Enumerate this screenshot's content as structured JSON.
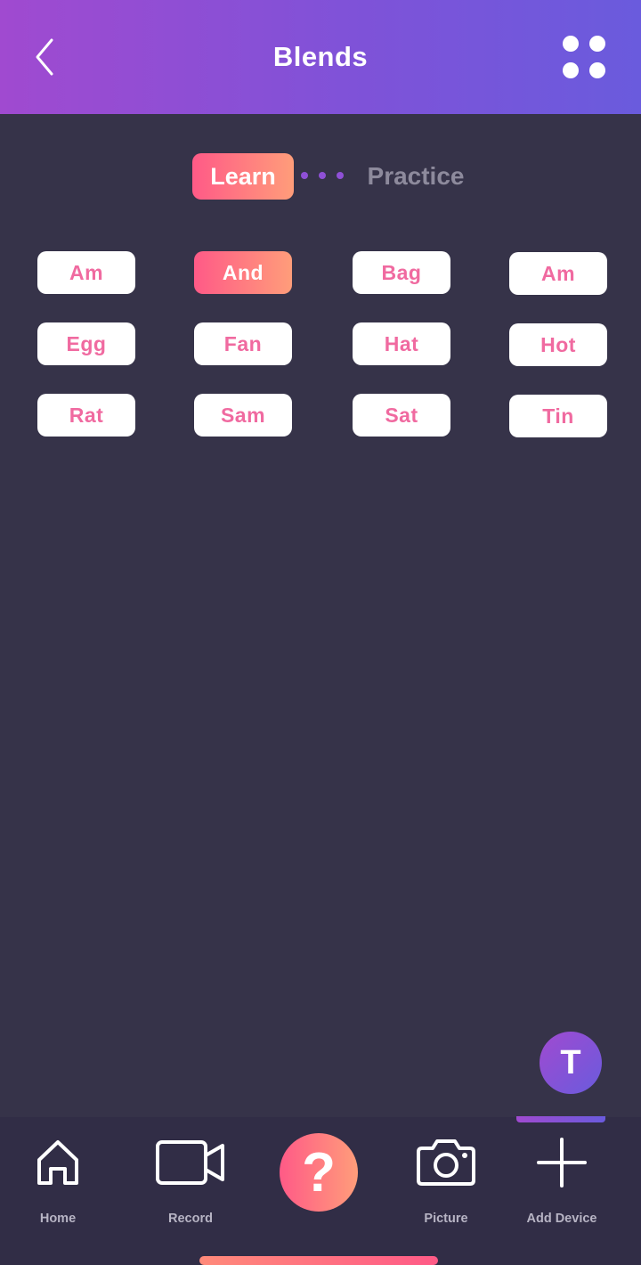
{
  "header": {
    "title": "Blends",
    "back_icon": "chevron-left-icon",
    "menu_icon": "grid-dots-icon"
  },
  "mode_toggle": {
    "learn_label": "Learn",
    "practice_label": "Practice",
    "selected": "Learn"
  },
  "words": [
    {
      "label": "Am",
      "active": false
    },
    {
      "label": "And",
      "active": true
    },
    {
      "label": "Bag",
      "active": false
    },
    {
      "label": "Am",
      "active": false
    },
    {
      "label": "Egg",
      "active": false
    },
    {
      "label": "Fan",
      "active": false
    },
    {
      "label": "Hat",
      "active": false
    },
    {
      "label": "Hot",
      "active": false
    },
    {
      "label": "Rat",
      "active": false
    },
    {
      "label": "Sam",
      "active": false
    },
    {
      "label": "Sat",
      "active": false
    },
    {
      "label": "Tin",
      "active": false
    }
  ],
  "profile": {
    "initial": "T"
  },
  "tabbar": {
    "home": {
      "label": "Home",
      "icon": "home-icon"
    },
    "record": {
      "label": "Record",
      "icon": "video-camera-icon"
    },
    "help": {
      "glyph": "?",
      "icon": "question-icon"
    },
    "picture": {
      "label": "Picture",
      "icon": "camera-icon"
    },
    "add_device": {
      "label": "Add Device",
      "icon": "plus-icon"
    }
  },
  "colors": {
    "background": "#363349",
    "header_gradient_start": "#a04ad0",
    "header_gradient_end": "#6a5bdd",
    "accent_gradient_start": "#ff5a87",
    "accent_gradient_end": "#ff9d7a",
    "word_text": "#f06aa0",
    "tabbar": "#312d46"
  }
}
